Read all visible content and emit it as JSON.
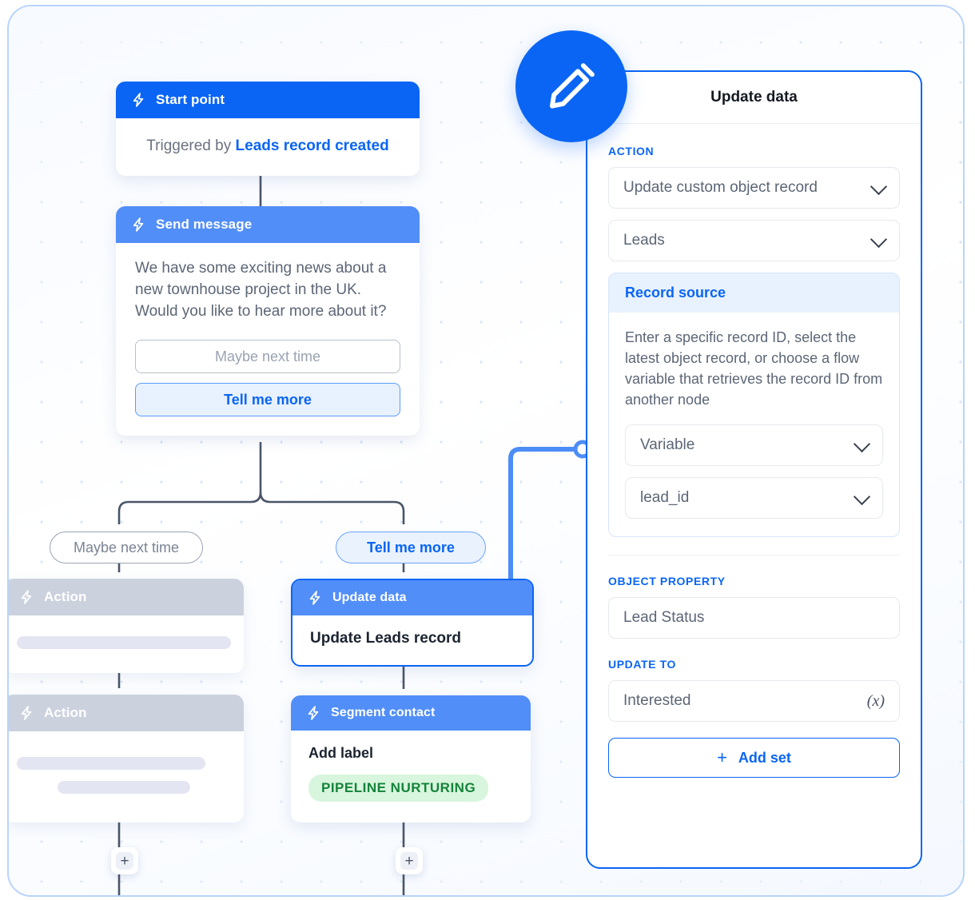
{
  "canvas": {
    "edit_fab_icon": "pencil-icon"
  },
  "flow": {
    "start_node": {
      "icon": "bolt-icon",
      "title": "Start point",
      "trigger_prefix": "Triggered by ",
      "trigger_value": "Leads record created"
    },
    "send_node": {
      "icon": "bolt-icon",
      "title": "Send message",
      "message": "We have some exciting news about a new townhouse project in the UK. Would you like to hear more about it?",
      "replies": [
        {
          "label": "Maybe next time",
          "style": "plain"
        },
        {
          "label": "Tell me more",
          "style": "primary"
        }
      ]
    },
    "branches": [
      {
        "label": "Maybe next time"
      },
      {
        "label": "Tell me more"
      }
    ],
    "action_nodes": [
      {
        "icon": "bolt-icon",
        "title": "Action"
      },
      {
        "icon": "bolt-icon",
        "title": "Action"
      }
    ],
    "update_node": {
      "icon": "bolt-icon",
      "title": "Update data",
      "body": "Update Leads record"
    },
    "segment_node": {
      "icon": "bolt-icon",
      "title": "Segment contact",
      "body": "Add label",
      "pill": "PIPELINE NURTURING",
      "pill_color": "#14843a",
      "pill_bg": "#d8f5dd"
    },
    "add_buttons": [
      {
        "label": "+"
      },
      {
        "label": "+"
      }
    ]
  },
  "panel": {
    "title": "Update data",
    "action_label": "ACTION",
    "action_select": "Update custom object record",
    "object_select": "Leads",
    "record_source": {
      "title": "Record source",
      "description": "Enter a specific record ID, select the latest object record, or choose a flow variable that retrieves the record ID from another node",
      "source_type": "Variable",
      "variable": "lead_id"
    },
    "object_property_label": "OBJECT PROPERTY",
    "object_property_value": "Lead Status",
    "update_to_label": "UPDATE TO",
    "update_to_value": "Interested",
    "update_to_icon": "fx-variable-icon",
    "add_set_label": "Add set",
    "add_set_icon": "plus-icon",
    "accent_color": "#0a65f5"
  }
}
